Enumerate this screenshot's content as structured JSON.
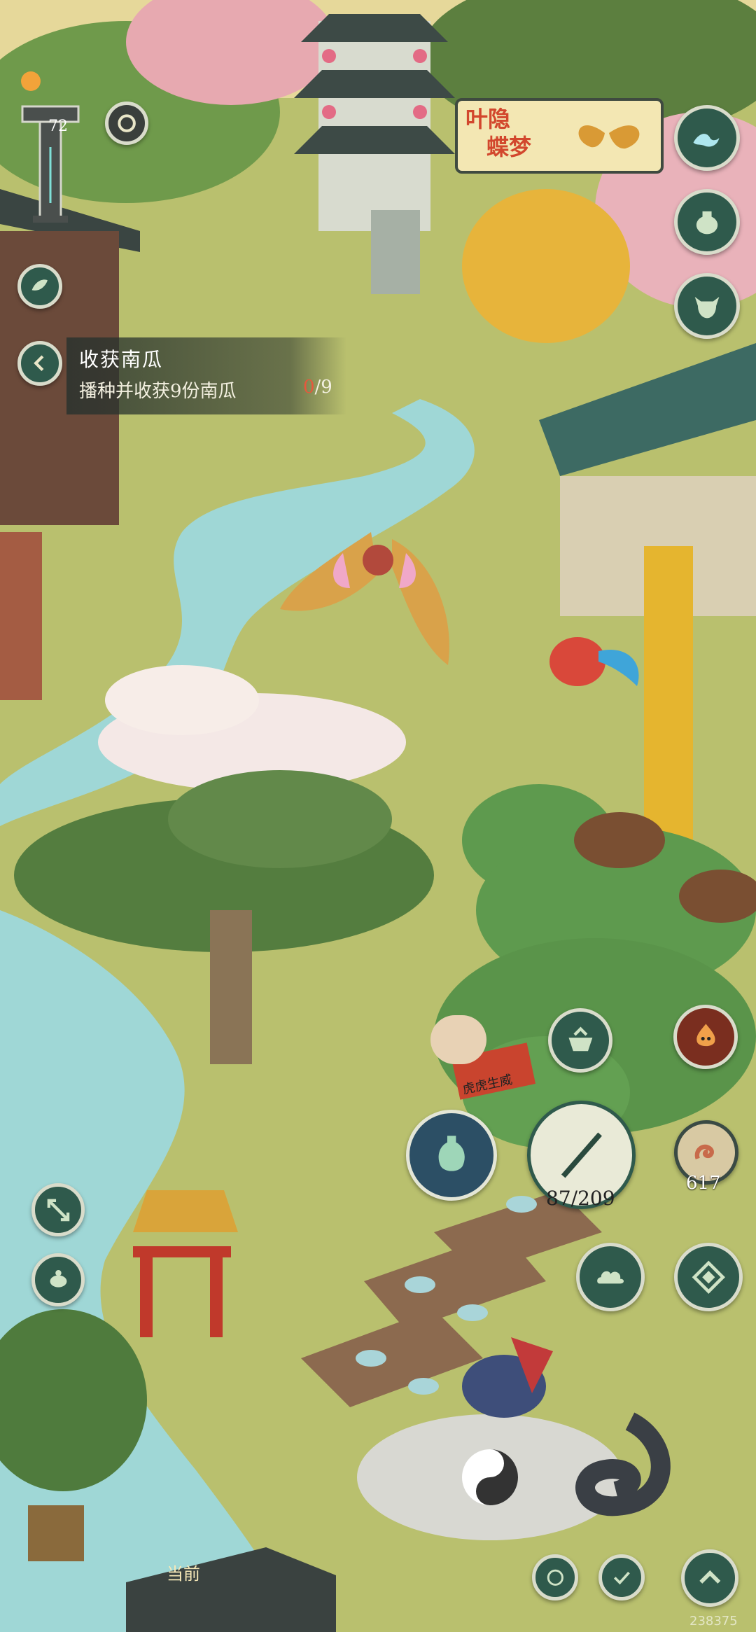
{
  "player": {
    "level": "72"
  },
  "quest": {
    "title": "收获南瓜",
    "description": "播种并收获9份南瓜",
    "progress_current": "0",
    "progress_total": "/9"
  },
  "event_banner": {
    "line1": "叶隐",
    "line2": "蝶梦"
  },
  "sign": {
    "text": "虎虎生威"
  },
  "tools": {
    "durability": "87/209",
    "bait_count": "617"
  },
  "location": {
    "current_label": "当前"
  },
  "watermark": "238375",
  "colors": {
    "button_bg": "#2f5a4c",
    "button_border": "#d9dccb",
    "grass": "#b9c06e",
    "water": "#9fd7d6",
    "accent_red": "#e8573c"
  },
  "icons": {
    "menu_right": [
      "wave-icon",
      "pot-icon",
      "ox-icon"
    ],
    "left_column": [
      "leaf-icon",
      "back-arrow-icon",
      "expand-icon",
      "turtle-icon"
    ],
    "bottom_right": [
      "cloud-icon",
      "compass-icon",
      "up-arrow-icon"
    ],
    "field_markers": [
      "cauldron-icon",
      "fire-face-icon",
      "vase-icon",
      "fishing-rod-icon",
      "worm-icon"
    ]
  }
}
